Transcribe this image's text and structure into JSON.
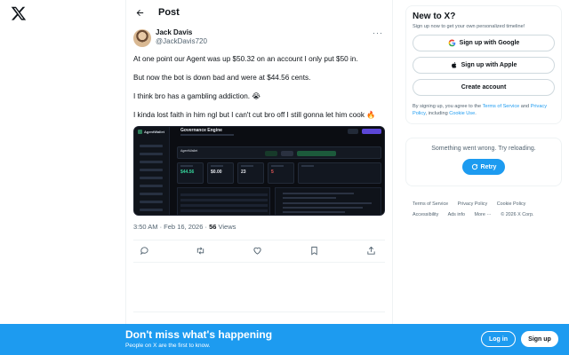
{
  "nav": {
    "logo_icon": "x-logo-icon"
  },
  "header": {
    "title": "Post",
    "back_icon": "arrow-left-icon"
  },
  "post": {
    "author": {
      "display_name": "Jack Davis",
      "handle": "@JackDavis720"
    },
    "paragraphs": [
      "At one point our Agent was up $50.32 on an account I only put $50 in.",
      "But now the bot is down bad and were at $44.56 cents.",
      "I think bro has a gambling addiction. 😭",
      "I kinda lost faith in him ngl but I can't cut bro off I still gonna let him cook 🔥"
    ],
    "media": {
      "brand": "AgentWallet",
      "title": "Governance Engine",
      "stats": [
        "$44.56",
        "$0.00",
        "23",
        "5"
      ],
      "agent_label": "AgentWallet"
    },
    "time": "3:50 AM · Feb 16, 2026 · ",
    "views_count": "56",
    "views_label": " Views",
    "actions": [
      "reply-icon",
      "repost-icon",
      "like-icon",
      "bookmark-icon",
      "share-icon"
    ]
  },
  "sidebar": {
    "new_to_x": {
      "title": "New to X?",
      "subtitle": "Sign up now to get your own personalized timeline!",
      "google_label": "Sign up with Google",
      "apple_label": "Sign up with Apple",
      "create_label": "Create account",
      "tos_prefix": "By signing up, you agree to the ",
      "tos_link": "Terms of Service",
      "tos_and": " and ",
      "privacy_link": "Privacy Policy",
      "tos_including": ", including ",
      "cookie_link": "Cookie Use",
      "tos_end": "."
    },
    "error": {
      "text": "Something went wrong. Try reloading.",
      "retry_label": "Retry"
    },
    "footer": {
      "row1": [
        "Terms of Service",
        "Privacy Policy",
        "Cookie Policy"
      ],
      "row2": [
        "Accessibility",
        "Ads info",
        "More ···",
        "© 2026 X Corp."
      ]
    }
  },
  "banner": {
    "title": "Don't miss what's happening",
    "subtitle": "People on X are the first to know.",
    "login_label": "Log in",
    "signup_label": "Sign up"
  },
  "colors": {
    "accent": "#1d9bf0",
    "text": "#0f1419",
    "muted": "#536471"
  }
}
